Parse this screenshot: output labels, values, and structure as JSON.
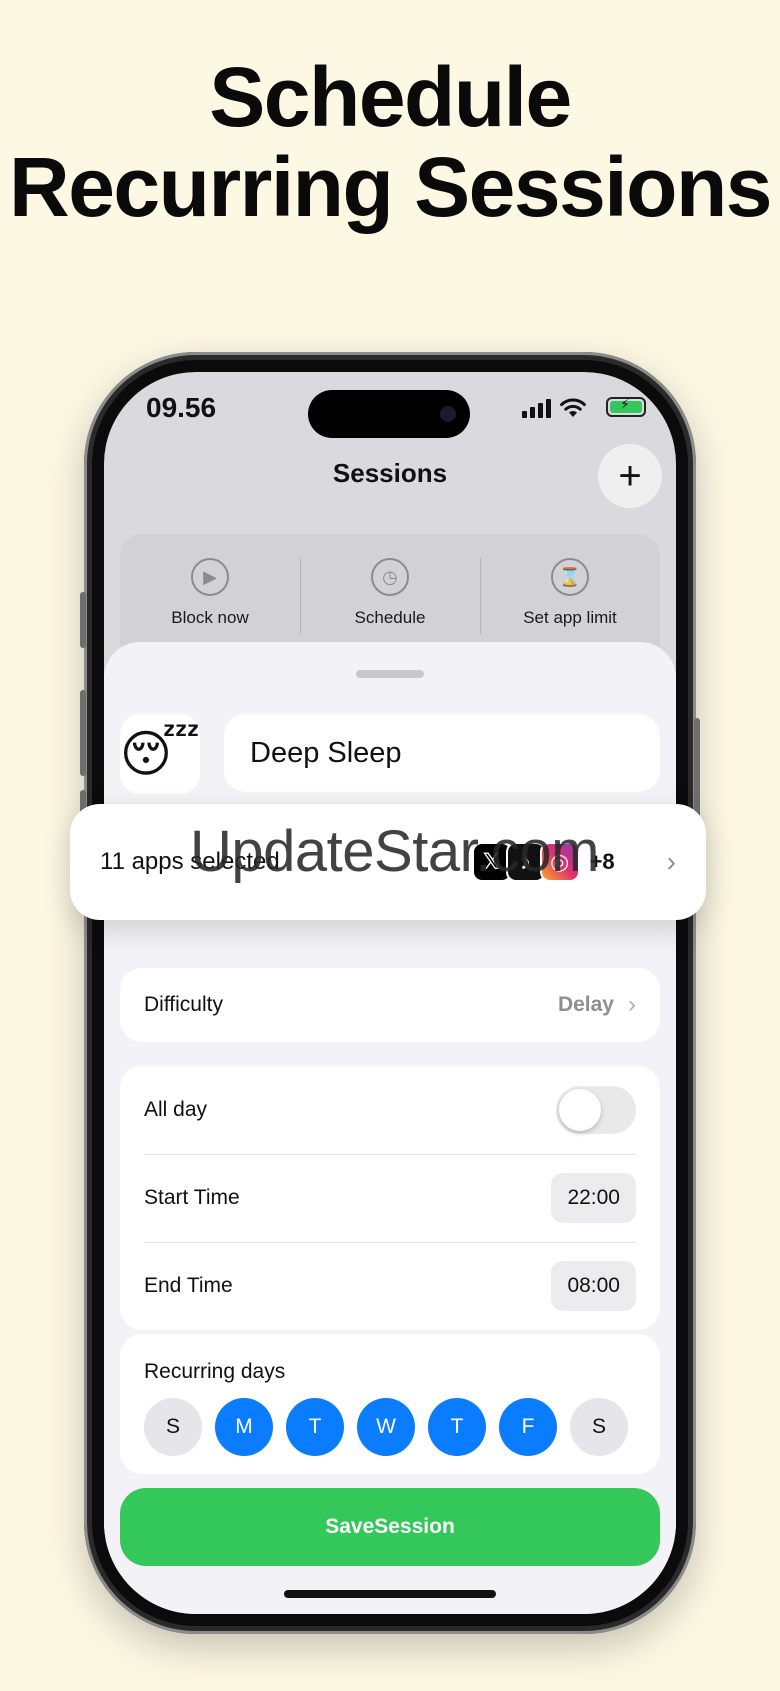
{
  "headline": {
    "line1": "Schedule",
    "line2": "Recurring Sessions"
  },
  "status_bar": {
    "time": "09.56",
    "icons": [
      "signal-icon",
      "wifi-icon",
      "battery-charging-icon"
    ]
  },
  "nav": {
    "title": "Sessions",
    "add_icon": "+"
  },
  "quick_actions": [
    {
      "label": "Block now",
      "icon": "play-icon",
      "glyph": "▶"
    },
    {
      "label": "Schedule",
      "icon": "clock-icon",
      "glyph": "◷"
    },
    {
      "label": "Set app limit",
      "icon": "hourglass-icon",
      "glyph": "⌛"
    }
  ],
  "session": {
    "emoji": "😴",
    "name": "Deep Sleep",
    "apps_label": "11 apps selected",
    "app_icons": [
      {
        "name": "x-app-icon",
        "glyph": "𝕏"
      },
      {
        "name": "tiktok-app-icon",
        "glyph": "♪"
      },
      {
        "name": "instagram-app-icon",
        "glyph": "◎"
      }
    ],
    "apps_more": "+8",
    "difficulty_label": "Difficulty",
    "difficulty_value": "Delay",
    "all_day_label": "All day",
    "all_day_on": false,
    "start_label": "Start Time",
    "start_value": "22:00",
    "end_label": "End Time",
    "end_value": "08:00",
    "recurring_label": "Recurring days",
    "days": [
      {
        "letter": "S",
        "on": false
      },
      {
        "letter": "M",
        "on": true
      },
      {
        "letter": "T",
        "on": true
      },
      {
        "letter": "W",
        "on": true
      },
      {
        "letter": "T",
        "on": true
      },
      {
        "letter": "F",
        "on": true
      },
      {
        "letter": "S",
        "on": false
      }
    ],
    "save_label": "SaveSession"
  },
  "watermark": "UpdateStar.com",
  "colors": {
    "background": "#fdf8e4",
    "accent_blue": "#0a7cff",
    "save_green": "#34c759"
  }
}
